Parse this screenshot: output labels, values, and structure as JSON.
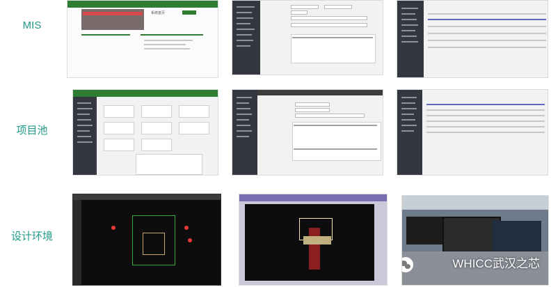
{
  "rows": [
    {
      "label": "MIS"
    },
    {
      "label": "项目池"
    },
    {
      "label": "设计环境"
    }
  ],
  "thumbs": {
    "mis_1": {
      "caption": "系统首页"
    },
    "mis_2": {
      "caption": ""
    },
    "mis_3": {
      "caption": ""
    },
    "pool_1": {
      "caption": ""
    },
    "pool_2": {
      "caption": ""
    },
    "pool_3": {
      "caption": ""
    },
    "design_1": {
      "caption": ""
    },
    "design_2": {
      "caption": ""
    },
    "design_3": {
      "caption": ""
    }
  },
  "watermark": {
    "text": "WHICC武汉之芯",
    "icon": "wechat-icon"
  },
  "colors": {
    "label": "#1f9a8a",
    "sidebar": "#333840",
    "cad_bg": "#0d0d0d",
    "accent_red": "#e53935",
    "accent_green": "#2e7d32"
  }
}
